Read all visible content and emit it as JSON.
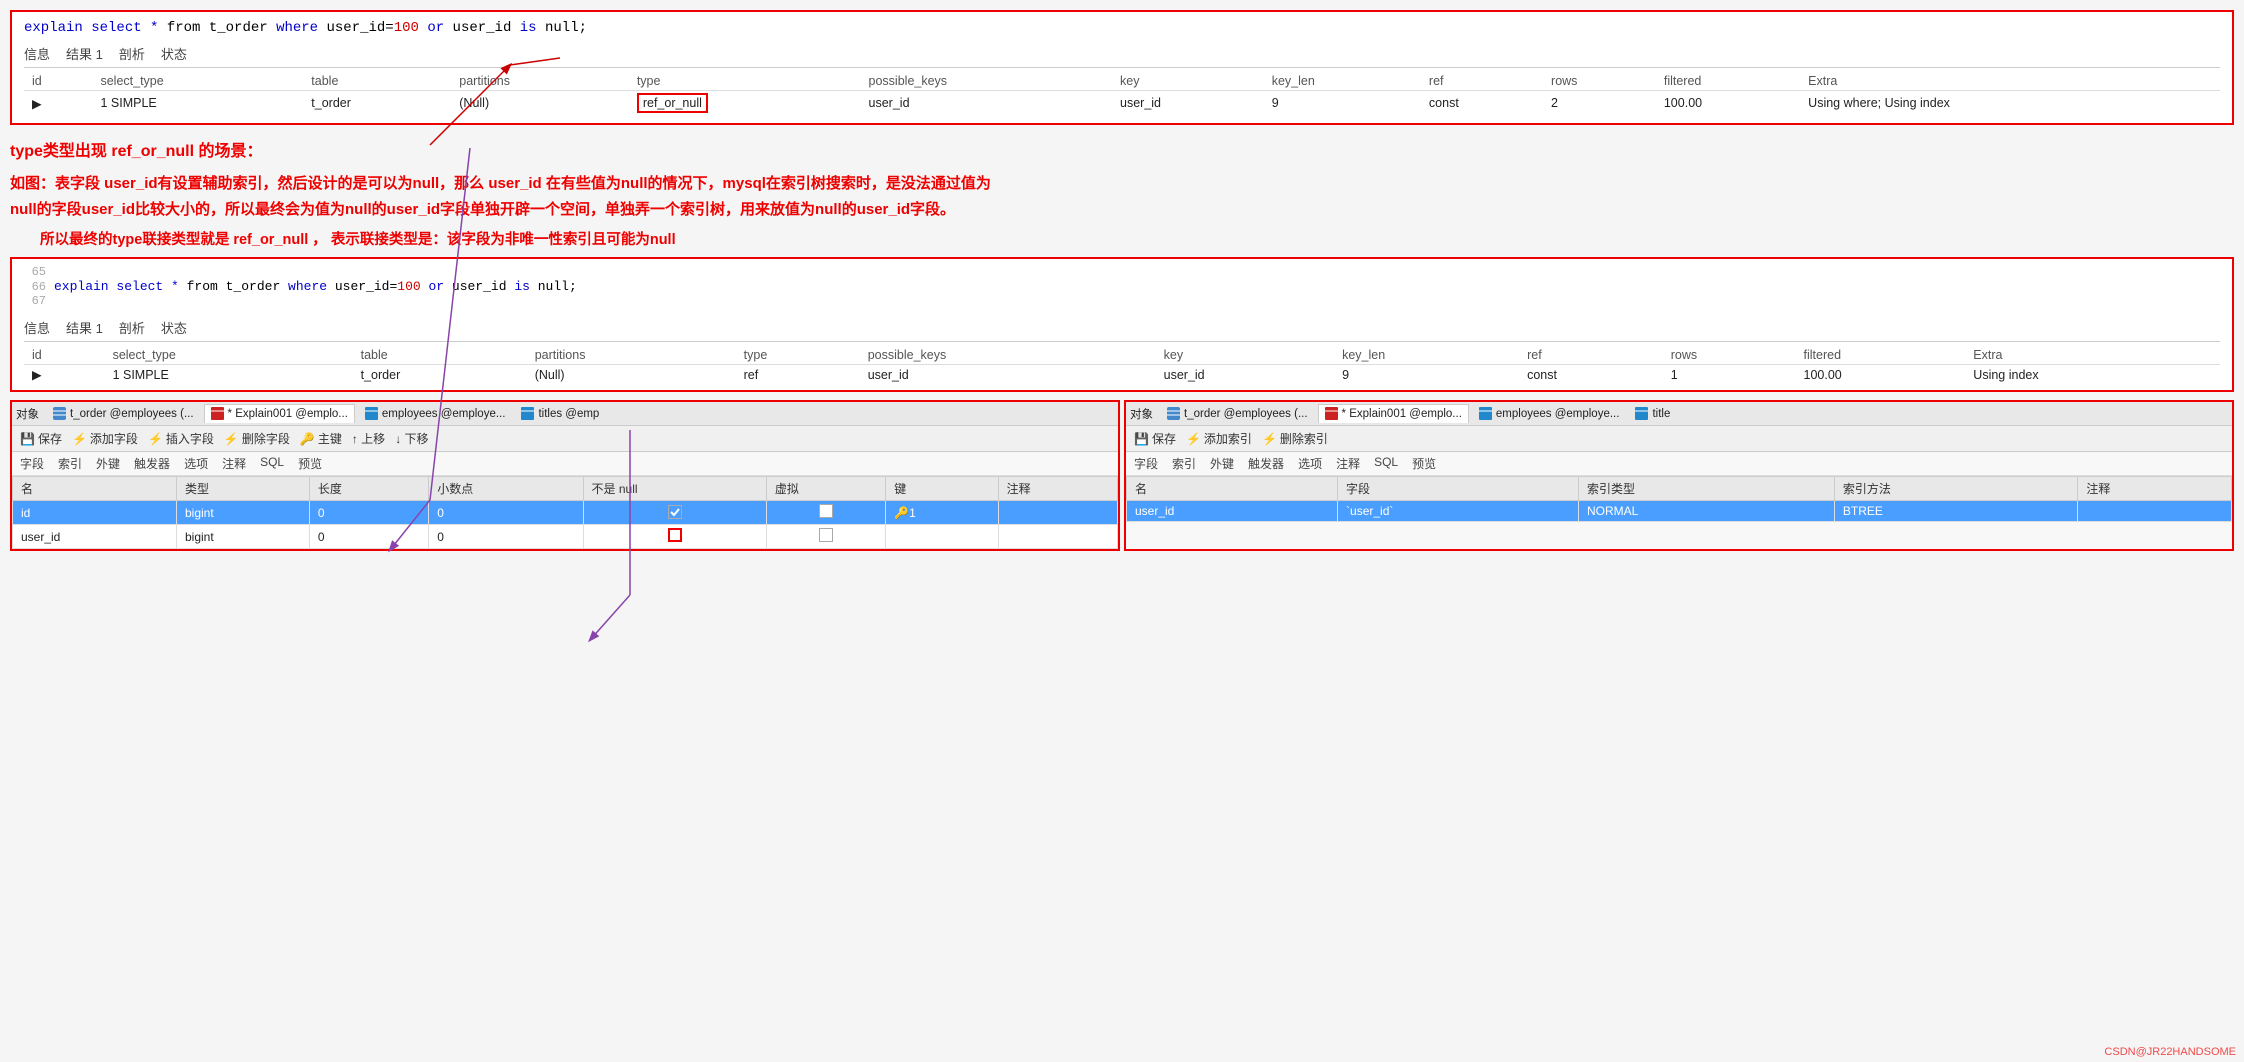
{
  "top_sql_box": {
    "sql_line": "explain select * from t_order where user_id=100 or user_id is null;",
    "sql_keywords": [
      "explain",
      "select",
      "from",
      "where",
      "or",
      "is"
    ],
    "tabs": [
      "信息",
      "结果 1",
      "剖析",
      "状态"
    ],
    "table_headers": [
      "id",
      "select_type",
      "table",
      "partitions",
      "type",
      "possible_keys",
      "key",
      "key_len",
      "ref",
      "rows",
      "filtered",
      "Extra"
    ],
    "table_rows": [
      {
        "marker": "▶",
        "id": "1",
        "select_type": "SIMPLE",
        "table": "t_order",
        "partitions": "(Null)",
        "type": "ref_or_null",
        "possible_keys": "user_id",
        "key": "user_id",
        "key_len": "9",
        "ref": "const",
        "rows": "2",
        "filtered": "100.00",
        "extra": "Using where; Using index"
      }
    ]
  },
  "annotation": {
    "title": "type类型出现 ref_or_null 的场景：",
    "body_line1": "如图：表字段 user_id有设置辅助索引，然后设计的是可以为null，那么 user_id 在有些值为null的情况下，mysql在索引树搜索时，是没法通过值为",
    "body_line2": "null的字段user_id比较大小的，所以最终会为值为null的user_id字段单独开辟一个空间，单独弄一个索引树，用来放值为null的user_id字段。",
    "body_line3": "所以最终的type联接类型就是 ref_or_null ，  表示联接类型是：该字段为非唯一性索引且可能为null"
  },
  "second_sql_box": {
    "lines": [
      {
        "num": "65",
        "content": ""
      },
      {
        "num": "66",
        "content": "explain select * from t_order where user_id=100 or user_id is null;"
      },
      {
        "num": "67",
        "content": ""
      }
    ],
    "tabs": [
      "信息",
      "结果 1",
      "剖析",
      "状态"
    ],
    "table_headers": [
      "id",
      "select_type",
      "table",
      "partitions",
      "type",
      "possible_keys",
      "key",
      "key_len",
      "ref",
      "rows",
      "filtered",
      "Extra"
    ],
    "table_rows": [
      {
        "marker": "▶",
        "id": "1",
        "select_type": "SIMPLE",
        "table": "t_order",
        "partitions": "(Null)",
        "type": "ref",
        "possible_keys": "user_id",
        "key": "user_id",
        "key_len": "9",
        "ref": "const",
        "rows": "1",
        "filtered": "100.00",
        "extra": "Using index"
      }
    ]
  },
  "panel_left": {
    "object_label": "对象",
    "tabs": [
      {
        "label": "t_order @employees (...",
        "icon": "db"
      },
      {
        "label": "* Explain001 @emplo...",
        "icon": "table-red"
      },
      {
        "label": "employees @employe...",
        "icon": "table-blue"
      },
      {
        "label": "titles @emp",
        "icon": "table-blue"
      }
    ],
    "toolbar": {
      "save": "保存",
      "add_field": "添加字段",
      "insert_field": "插入字段",
      "delete_field": "删除字段",
      "primary_key": "主键",
      "move_up": "↑ 上移",
      "move_down": "↓ 下移"
    },
    "sub_tabs": [
      "字段",
      "索引",
      "外键",
      "触发器",
      "选项",
      "注释",
      "SQL",
      "预览"
    ],
    "col_headers": [
      "名",
      "类型",
      "长度",
      "小数点",
      "不是 null",
      "虚拟",
      "键",
      "注释"
    ],
    "rows": [
      {
        "name": "id",
        "type": "bigint",
        "length": "0",
        "decimal": "0",
        "not_null": true,
        "virtual": false,
        "key": "🔑1",
        "comment": "",
        "selected": true
      },
      {
        "name": "user_id",
        "type": "bigint",
        "length": "0",
        "decimal": "0",
        "not_null": false,
        "virtual": false,
        "key": "",
        "comment": "",
        "selected": false
      }
    ]
  },
  "panel_right": {
    "object_label": "对象",
    "tabs": [
      {
        "label": "t_order @employees (...",
        "icon": "db"
      },
      {
        "label": "* Explain001 @emplo...",
        "icon": "table-red"
      },
      {
        "label": "employees @employe...",
        "icon": "table-blue"
      },
      {
        "label": "title",
        "icon": "table-blue"
      }
    ],
    "toolbar": {
      "save": "保存",
      "add_index": "添加索引",
      "delete_index": "删除索引"
    },
    "sub_tabs": [
      "字段",
      "索引",
      "外键",
      "触发器",
      "选项",
      "注释",
      "SQL",
      "预览"
    ],
    "col_headers": [
      "名",
      "字段",
      "索引类型",
      "索引方法",
      "注释"
    ],
    "rows": [
      {
        "name": "user_id",
        "field": "`user_id`",
        "index_type": "NORMAL",
        "index_method": "BTREE",
        "comment": "",
        "selected": true
      }
    ]
  },
  "watermark": "CSDN@JR22HANDSOME"
}
